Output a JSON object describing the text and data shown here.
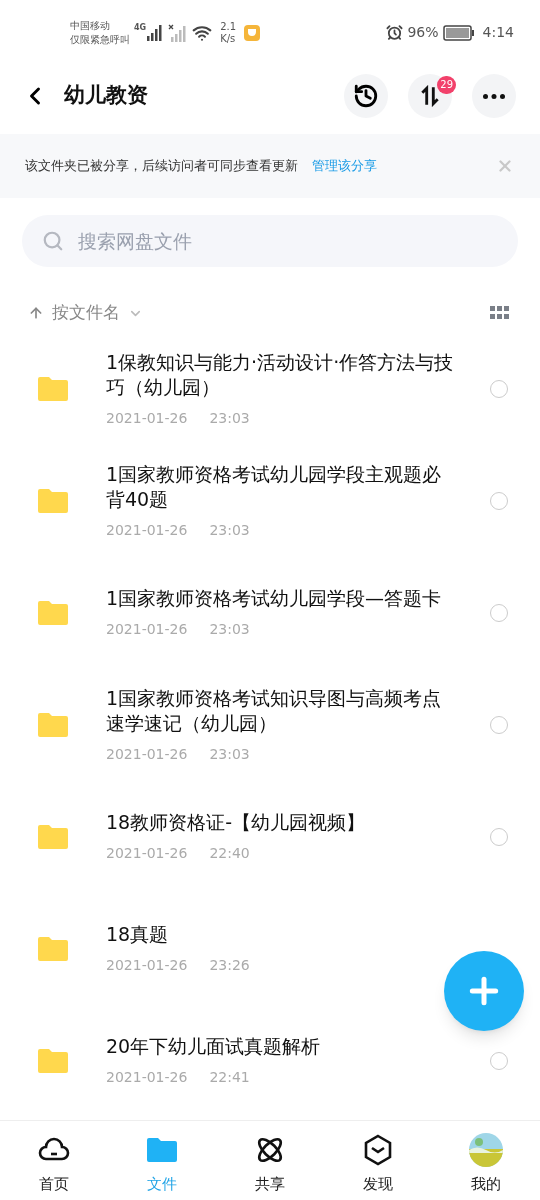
{
  "status_bar": {
    "carrier": "中国移动",
    "carrier_note": "仅限紧急呼叫",
    "network": "4G",
    "speed_value": "2.1",
    "speed_unit": "K/s",
    "battery": "96%",
    "time": "4:14"
  },
  "header": {
    "title": "幼儿教资",
    "transfer_badge": "29"
  },
  "banner": {
    "text": "该文件夹已被分享，后续访问者可同步查看更新",
    "link": "管理该分享"
  },
  "search": {
    "placeholder": "搜索网盘文件"
  },
  "sort": {
    "label": "按文件名"
  },
  "files": [
    {
      "name": "1保教知识与能力·活动设计·作答方法与技巧（幼儿园）",
      "date": "2021-01-26",
      "time": "23:03",
      "selected": false
    },
    {
      "name": "1国家教师资格考试幼儿园学段主观题必背40题",
      "date": "2021-01-26",
      "time": "23:03",
      "selected": false
    },
    {
      "name": "1国家教师资格考试幼儿园学段—答题卡",
      "date": "2021-01-26",
      "time": "23:03",
      "selected": false
    },
    {
      "name": "1国家教师资格考试知识导图与高频考点速学速记（幼儿园）",
      "date": "2021-01-26",
      "time": "23:03",
      "selected": false
    },
    {
      "name": "18教师资格证-【幼儿园视频】",
      "date": "2021-01-26",
      "time": "22:40",
      "selected": false
    },
    {
      "name": "18真题",
      "date": "2021-01-26",
      "time": "23:26"
    },
    {
      "name": "20年下幼儿面试真题解析",
      "date": "2021-01-26",
      "time": "22:41",
      "selected": false
    }
  ],
  "nav": [
    {
      "kind": "home",
      "label": "首页",
      "selected": false
    },
    {
      "kind": "files",
      "label": "文件",
      "selected": true
    },
    {
      "kind": "share",
      "label": "共享",
      "selected": false
    },
    {
      "kind": "discover",
      "label": "发现",
      "selected": false
    },
    {
      "kind": "avatar",
      "label": "我的",
      "selected": false
    }
  ]
}
